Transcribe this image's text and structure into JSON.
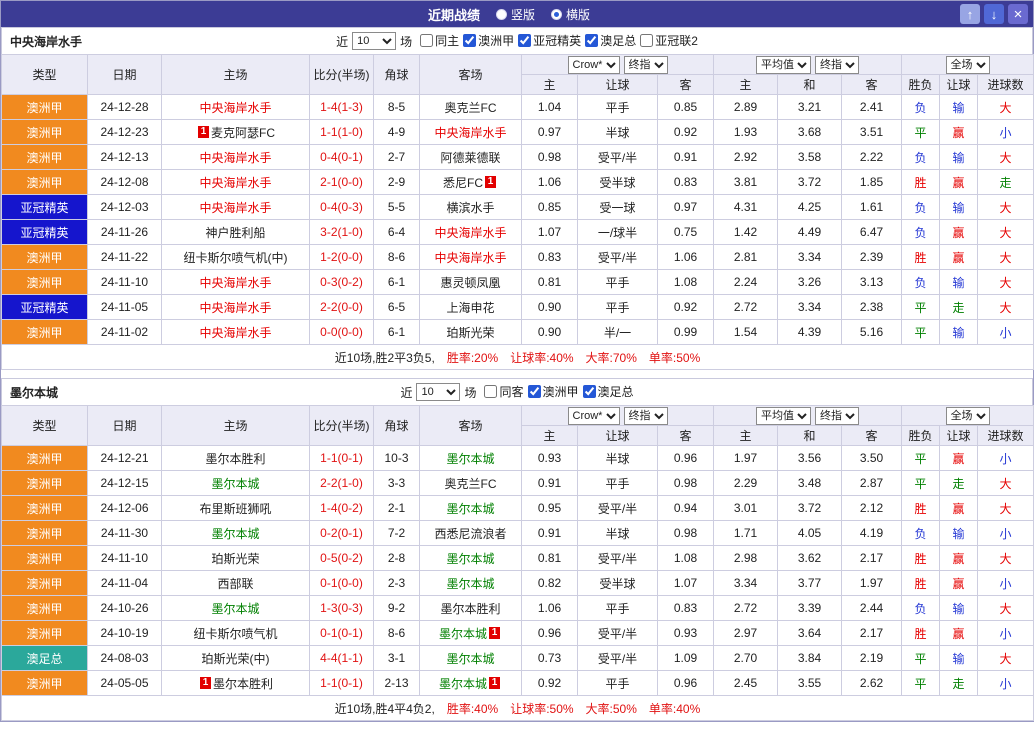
{
  "titlebar": {
    "title": "近期战绩",
    "radios": [
      {
        "label": "竖版",
        "selected": false
      },
      {
        "label": "横版",
        "selected": true
      }
    ],
    "buttons": {
      "up": "↑",
      "down": "↓",
      "close": "×"
    }
  },
  "filter": {
    "near_label": "近",
    "count": "10",
    "games_label": "场"
  },
  "table_header": {
    "cols": [
      "类型",
      "日期",
      "主场",
      "比分(半场)",
      "角球",
      "客场"
    ],
    "odds_group": {
      "source_select": "Crow*",
      "final_select": "终指",
      "sub": [
        "主",
        "让球",
        "客"
      ]
    },
    "avg_group": {
      "avg_select": "平均值",
      "final_select": "终指",
      "sub": [
        "主",
        "和",
        "客"
      ]
    },
    "result_group": {
      "scope_select": "全场",
      "sub": [
        "胜负",
        "让球",
        "进球数"
      ]
    }
  },
  "maps": {
    "type_bg": {
      "澳洲甲": "#f18a1f",
      "亚冠精英": "#1515cd",
      "澳足总": "#2ba89b"
    },
    "team_color": {
      "r": "#e60000",
      "g": "#008000",
      "k": "#222222"
    },
    "outcome": {
      "胜": "#e60000",
      "赢": "#e60000",
      "大": "#e60000",
      "平": "#008000",
      "走": "#008000",
      "负": "#2336d4",
      "输": "#2336d4",
      "小": "#2336d4"
    }
  },
  "sections": [
    {
      "team": "中央海岸水手",
      "filters": [
        {
          "label": "同主",
          "checked": false
        },
        {
          "label": "澳洲甲",
          "checked": true
        },
        {
          "label": "亚冠精英",
          "checked": true
        },
        {
          "label": "澳足总",
          "checked": true
        },
        {
          "label": "亚冠联2",
          "checked": false
        }
      ],
      "rows": [
        {
          "t": "澳洲甲",
          "d": "24-12-28",
          "h": {
            "n": "中央海岸水手",
            "c": "r"
          },
          "s": "1-4(1-3)",
          "cn": "8-5",
          "a": {
            "n": "奥克兰FC"
          },
          "o": [
            "1.04",
            "平手",
            "0.85"
          ],
          "v": [
            "2.89",
            "3.21",
            "2.41"
          ],
          "r": [
            "负",
            "输",
            "大"
          ]
        },
        {
          "t": "澳洲甲",
          "d": "24-12-23",
          "h": {
            "n": "麦克阿瑟FC",
            "b1": "1"
          },
          "s": "1-1(1-0)",
          "cn": "4-9",
          "a": {
            "n": "中央海岸水手",
            "c": "r"
          },
          "o": [
            "0.97",
            "半球",
            "0.92"
          ],
          "v": [
            "1.93",
            "3.68",
            "3.51"
          ],
          "r": [
            "平",
            "赢",
            "小"
          ]
        },
        {
          "t": "澳洲甲",
          "d": "24-12-13",
          "h": {
            "n": "中央海岸水手",
            "c": "r"
          },
          "s": "0-4(0-1)",
          "cn": "2-7",
          "a": {
            "n": "阿德莱德联"
          },
          "o": [
            "0.98",
            "受平/半",
            "0.91"
          ],
          "v": [
            "2.92",
            "3.58",
            "2.22"
          ],
          "r": [
            "负",
            "输",
            "大"
          ]
        },
        {
          "t": "澳洲甲",
          "d": "24-12-08",
          "h": {
            "n": "中央海岸水手",
            "c": "r"
          },
          "s": "2-1(0-0)",
          "cn": "2-9",
          "a": {
            "n": "悉尼FC",
            "b2": "1"
          },
          "o": [
            "1.06",
            "受半球",
            "0.83"
          ],
          "v": [
            "3.81",
            "3.72",
            "1.85"
          ],
          "r": [
            "胜",
            "赢",
            "走"
          ]
        },
        {
          "t": "亚冠精英",
          "d": "24-12-03",
          "h": {
            "n": "中央海岸水手",
            "c": "r"
          },
          "s": "0-4(0-3)",
          "cn": "5-5",
          "a": {
            "n": "横滨水手"
          },
          "o": [
            "0.85",
            "受一球",
            "0.97"
          ],
          "v": [
            "4.31",
            "4.25",
            "1.61"
          ],
          "r": [
            "负",
            "输",
            "大"
          ]
        },
        {
          "t": "亚冠精英",
          "d": "24-11-26",
          "h": {
            "n": "神户胜利船"
          },
          "s": "3-2(1-0)",
          "cn": "6-4",
          "a": {
            "n": "中央海岸水手",
            "c": "r"
          },
          "o": [
            "1.07",
            "一/球半",
            "0.75"
          ],
          "v": [
            "1.42",
            "4.49",
            "6.47"
          ],
          "r": [
            "负",
            "赢",
            "大"
          ]
        },
        {
          "t": "澳洲甲",
          "d": "24-11-22",
          "h": {
            "n": "纽卡斯尔喷气机(中)"
          },
          "s": "1-2(0-0)",
          "cn": "8-6",
          "a": {
            "n": "中央海岸水手",
            "c": "r"
          },
          "o": [
            "0.83",
            "受平/半",
            "1.06"
          ],
          "v": [
            "2.81",
            "3.34",
            "2.39"
          ],
          "r": [
            "胜",
            "赢",
            "大"
          ]
        },
        {
          "t": "澳洲甲",
          "d": "24-11-10",
          "h": {
            "n": "中央海岸水手",
            "c": "r"
          },
          "s": "0-3(0-2)",
          "cn": "6-1",
          "a": {
            "n": "惠灵顿凤凰"
          },
          "o": [
            "0.81",
            "平手",
            "1.08"
          ],
          "v": [
            "2.24",
            "3.26",
            "3.13"
          ],
          "r": [
            "负",
            "输",
            "大"
          ]
        },
        {
          "t": "亚冠精英",
          "d": "24-11-05",
          "h": {
            "n": "中央海岸水手",
            "c": "r"
          },
          "s": "2-2(0-0)",
          "cn": "6-5",
          "a": {
            "n": "上海申花"
          },
          "o": [
            "0.90",
            "平手",
            "0.92"
          ],
          "v": [
            "2.72",
            "3.34",
            "2.38"
          ],
          "r": [
            "平",
            "走",
            "大"
          ]
        },
        {
          "t": "澳洲甲",
          "d": "24-11-02",
          "h": {
            "n": "中央海岸水手",
            "c": "r"
          },
          "s": "0-0(0-0)",
          "cn": "6-1",
          "a": {
            "n": "珀斯光荣"
          },
          "o": [
            "0.90",
            "半/一",
            "0.99"
          ],
          "v": [
            "1.54",
            "4.39",
            "5.16"
          ],
          "r": [
            "平",
            "输",
            "小"
          ]
        }
      ],
      "summary": {
        "record": "近10场,胜2平3负5,",
        "stats": [
          "胜率:20%",
          "让球率:40%",
          "大率:70%",
          "单率:50%"
        ]
      }
    },
    {
      "team": "墨尔本城",
      "filters": [
        {
          "label": "同客",
          "checked": false
        },
        {
          "label": "澳洲甲",
          "checked": true
        },
        {
          "label": "澳足总",
          "checked": true
        }
      ],
      "rows": [
        {
          "t": "澳洲甲",
          "d": "24-12-21",
          "h": {
            "n": "墨尔本胜利"
          },
          "s": "1-1(0-1)",
          "cn": "10-3",
          "a": {
            "n": "墨尔本城",
            "c": "g"
          },
          "o": [
            "0.93",
            "半球",
            "0.96"
          ],
          "v": [
            "1.97",
            "3.56",
            "3.50"
          ],
          "r": [
            "平",
            "赢",
            "小"
          ]
        },
        {
          "t": "澳洲甲",
          "d": "24-12-15",
          "h": {
            "n": "墨尔本城",
            "c": "g"
          },
          "s": "2-2(1-0)",
          "cn": "3-3",
          "a": {
            "n": "奥克兰FC"
          },
          "o": [
            "0.91",
            "平手",
            "0.98"
          ],
          "v": [
            "2.29",
            "3.48",
            "2.87"
          ],
          "r": [
            "平",
            "走",
            "大"
          ]
        },
        {
          "t": "澳洲甲",
          "d": "24-12-06",
          "h": {
            "n": "布里斯班狮吼"
          },
          "s": "1-4(0-2)",
          "cn": "2-1",
          "a": {
            "n": "墨尔本城",
            "c": "g"
          },
          "o": [
            "0.95",
            "受平/半",
            "0.94"
          ],
          "v": [
            "3.01",
            "3.72",
            "2.12"
          ],
          "r": [
            "胜",
            "赢",
            "大"
          ]
        },
        {
          "t": "澳洲甲",
          "d": "24-11-30",
          "h": {
            "n": "墨尔本城",
            "c": "g"
          },
          "s": "0-2(0-1)",
          "cn": "7-2",
          "a": {
            "n": "西悉尼流浪者"
          },
          "o": [
            "0.91",
            "半球",
            "0.98"
          ],
          "v": [
            "1.71",
            "4.05",
            "4.19"
          ],
          "r": [
            "负",
            "输",
            "小"
          ]
        },
        {
          "t": "澳洲甲",
          "d": "24-11-10",
          "h": {
            "n": "珀斯光荣"
          },
          "s": "0-5(0-2)",
          "cn": "2-8",
          "a": {
            "n": "墨尔本城",
            "c": "g"
          },
          "o": [
            "0.81",
            "受平/半",
            "1.08"
          ],
          "v": [
            "2.98",
            "3.62",
            "2.17"
          ],
          "r": [
            "胜",
            "赢",
            "大"
          ]
        },
        {
          "t": "澳洲甲",
          "d": "24-11-04",
          "h": {
            "n": "西部联"
          },
          "s": "0-1(0-0)",
          "cn": "2-3",
          "a": {
            "n": "墨尔本城",
            "c": "g"
          },
          "o": [
            "0.82",
            "受半球",
            "1.07"
          ],
          "v": [
            "3.34",
            "3.77",
            "1.97"
          ],
          "r": [
            "胜",
            "赢",
            "小"
          ]
        },
        {
          "t": "澳洲甲",
          "d": "24-10-26",
          "h": {
            "n": "墨尔本城",
            "c": "g"
          },
          "s": "1-3(0-3)",
          "cn": "9-2",
          "a": {
            "n": "墨尔本胜利"
          },
          "o": [
            "1.06",
            "平手",
            "0.83"
          ],
          "v": [
            "2.72",
            "3.39",
            "2.44"
          ],
          "r": [
            "负",
            "输",
            "大"
          ]
        },
        {
          "t": "澳洲甲",
          "d": "24-10-19",
          "h": {
            "n": "纽卡斯尔喷气机"
          },
          "s": "0-1(0-1)",
          "cn": "8-6",
          "a": {
            "n": "墨尔本城",
            "c": "g",
            "b2": "1"
          },
          "o": [
            "0.96",
            "受平/半",
            "0.93"
          ],
          "v": [
            "2.97",
            "3.64",
            "2.17"
          ],
          "r": [
            "胜",
            "赢",
            "小"
          ]
        },
        {
          "t": "澳足总",
          "d": "24-08-03",
          "h": {
            "n": "珀斯光荣(中)"
          },
          "s": "4-4(1-1)",
          "cn": "3-1",
          "a": {
            "n": "墨尔本城",
            "c": "g"
          },
          "o": [
            "0.73",
            "受平/半",
            "1.09"
          ],
          "v": [
            "2.70",
            "3.84",
            "2.19"
          ],
          "r": [
            "平",
            "输",
            "大"
          ]
        },
        {
          "t": "澳洲甲",
          "d": "24-05-05",
          "h": {
            "n": "墨尔本胜利",
            "b1": "1"
          },
          "s": "1-1(0-1)",
          "cn": "2-13",
          "a": {
            "n": "墨尔本城",
            "c": "g",
            "b2": "1"
          },
          "o": [
            "0.92",
            "平手",
            "0.96"
          ],
          "v": [
            "2.45",
            "3.55",
            "2.62"
          ],
          "r": [
            "平",
            "走",
            "小"
          ]
        }
      ],
      "summary": {
        "record": "近10场,胜4平4负2,",
        "stats": [
          "胜率:40%",
          "让球率:50%",
          "大率:50%",
          "单率:40%"
        ]
      }
    }
  ]
}
